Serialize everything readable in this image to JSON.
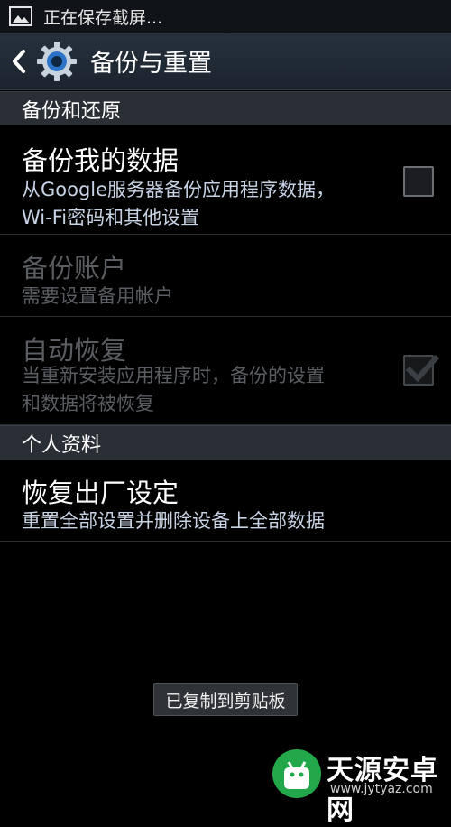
{
  "statusbar": {
    "icon": "image-icon",
    "text": "正在保存截屏..."
  },
  "actionbar": {
    "back_icon": "chevron-left-icon",
    "settings_icon": "gear-icon",
    "title": "备份与重置"
  },
  "sections": {
    "backup": {
      "header": "备份和还原",
      "backup_data": {
        "title": "备份我的数据",
        "summary": "从Google服务器备份应用程序数据，Wi-Fi密码和其他设置",
        "checked": false
      },
      "backup_account": {
        "title": "备份账户",
        "summary": "需要设置备用帐户",
        "enabled": false
      },
      "auto_restore": {
        "title": "自动恢复",
        "summary": "当重新安装应用程序时，备份的设置和数据将被恢复",
        "checked": true,
        "enabled": false
      }
    },
    "personal": {
      "header": "个人资料",
      "factory_reset": {
        "title": "恢复出厂设定",
        "summary": "重置全部设置并删除设备上全部数据"
      }
    }
  },
  "toast": {
    "text": "已复制到剪贴板"
  },
  "watermark": {
    "name": "天源安卓网",
    "url": "www.jytyaz.com"
  },
  "colors": {
    "background": "#000000",
    "section_header": "#2a2f35",
    "summary_text": "#c8d4e6",
    "watermark_green": "#22a84a"
  }
}
